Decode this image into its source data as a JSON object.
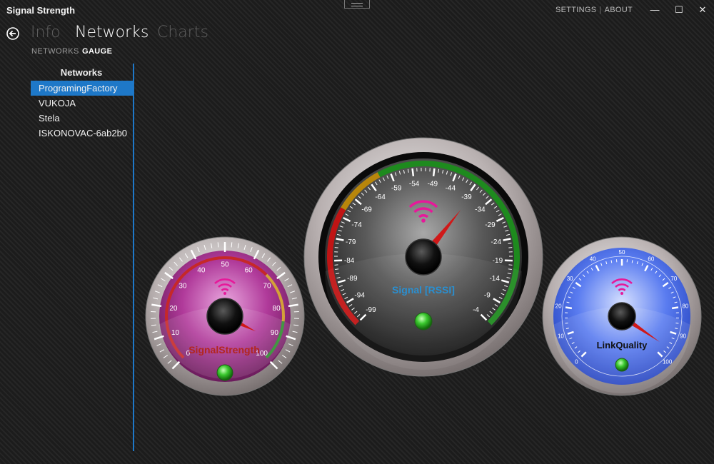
{
  "window": {
    "title": "Signal Strength"
  },
  "top_menu": {
    "settings": "SETTINGS",
    "separator": "|",
    "about": "ABOUT"
  },
  "window_controls": {
    "minimize": "—",
    "maximize": "☐",
    "close": "✕"
  },
  "nav": {
    "pivots": [
      {
        "label": "Info",
        "active": false
      },
      {
        "label": "Networks",
        "active": true
      },
      {
        "label": "Charts",
        "active": false
      }
    ],
    "sub_tabs": [
      {
        "label": "NETWORKS",
        "active": false
      },
      {
        "label": "GAUGE",
        "active": true
      }
    ]
  },
  "sidebar": {
    "title": "Networks",
    "items": [
      {
        "label": "ProgramingFactory",
        "selected": true
      },
      {
        "label": "VUKOJA",
        "selected": false
      },
      {
        "label": "Stela",
        "selected": false
      },
      {
        "label": "ISKONOVAC-6ab2b0",
        "selected": false
      }
    ]
  },
  "gauges": {
    "signal_strength": {
      "label": "SignalStrength",
      "value": 93,
      "ticks": [
        "0",
        "10",
        "20",
        "30",
        "40",
        "50",
        "60",
        "70",
        "80",
        "90",
        "100"
      ],
      "face_color": "#b03a9a",
      "label_color": "#b3261e"
    },
    "rssi": {
      "label": "Signal [RSSI]",
      "value": -38,
      "ticks": [
        "-99",
        "-94",
        "-89",
        "-84",
        "-79",
        "-74",
        "-69",
        "-64",
        "-59",
        "-54",
        "-49",
        "-44",
        "-39",
        "-34",
        "-29",
        "-24",
        "-19",
        "-14",
        "-9",
        "-4"
      ],
      "label_color": "#2a8fd0"
    },
    "link_quality": {
      "label": "LinkQuality",
      "value": 96,
      "ticks": [
        "0",
        "10",
        "20",
        "30",
        "40",
        "50",
        "60",
        "70",
        "80",
        "90",
        "100"
      ],
      "face_color": "#2f5de0",
      "label_color": "#111111"
    }
  },
  "colors": {
    "accent": "#1e78c8",
    "wifi_icon": "#e6199a",
    "needle": "#d01818",
    "status_led": "#3ac82e"
  }
}
